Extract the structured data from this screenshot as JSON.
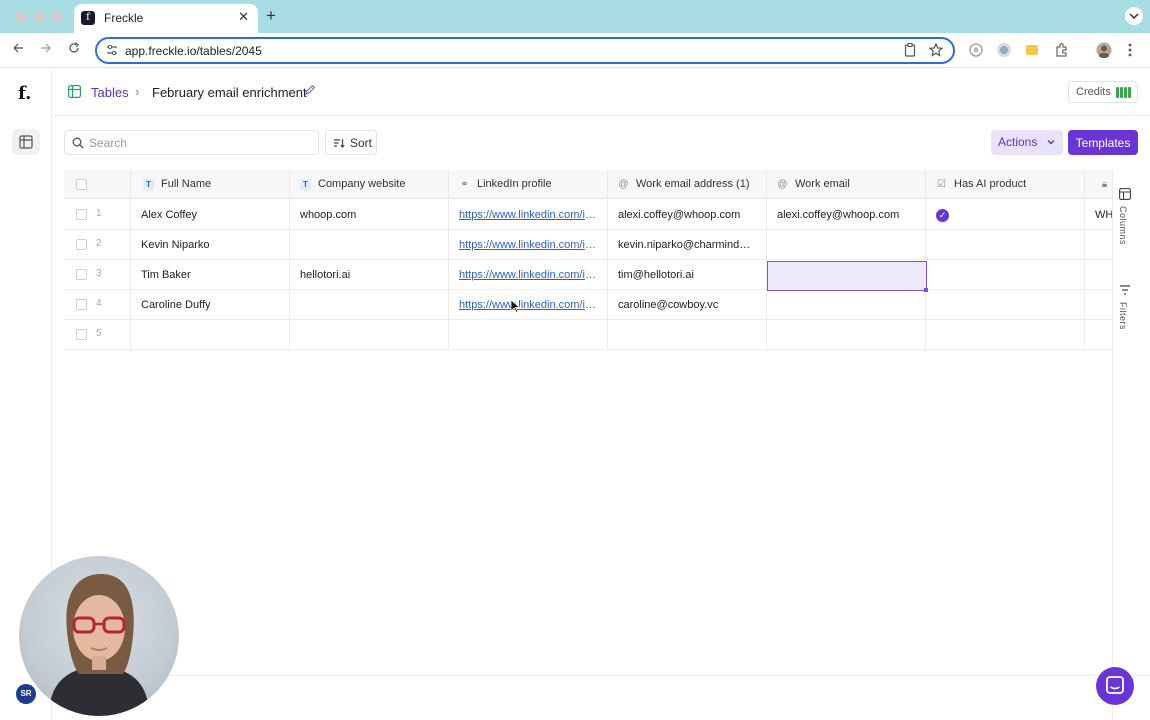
{
  "browser": {
    "tab_title": "Freckle",
    "tab_favicon_letter": "f",
    "url": "app.freckle.io/tables/2045"
  },
  "app": {
    "logo": "f.",
    "avatar_initials": "SR"
  },
  "breadcrumb": {
    "tables_label": "Tables",
    "separator": "›",
    "table_title": "February email enrichment"
  },
  "credits": {
    "label": "Credits",
    "level": 1.0
  },
  "toolbar": {
    "search_placeholder": "Search",
    "sort_label": "Sort",
    "actions_label": "Actions",
    "templates_label": "Templates"
  },
  "grid": {
    "columns": [
      {
        "label": "Full Name",
        "icon": "T"
      },
      {
        "label": "Company website",
        "icon": "T"
      },
      {
        "label": "LinkedIn profile",
        "icon": "link"
      },
      {
        "label": "Work email address (1)",
        "icon": "at"
      },
      {
        "label": "Work email",
        "icon": "at"
      },
      {
        "label": "Has AI product",
        "icon": "checkbox"
      }
    ],
    "rows": [
      {
        "num": "1",
        "full_name": "Alex Coffey",
        "company": "whoop.com",
        "linkedin": "https://www.linkedin.com/in...",
        "email1": "alexi.coffey@whoop.com",
        "email": "alexi.coffey@whoop.com",
        "has_ai": true,
        "extra": "WH"
      },
      {
        "num": "2",
        "full_name": "Kevin Niparko",
        "company": "",
        "linkedin": "https://www.linkedin.com/in...",
        "email1": "kevin.niparko@charmindust...",
        "email": "",
        "has_ai": false,
        "extra": ""
      },
      {
        "num": "3",
        "full_name": "Tim Baker",
        "company": "hellotori.ai",
        "linkedin": "https://www.linkedin.com/in...",
        "email1": "tim@hellotori.ai",
        "email": "",
        "has_ai": false,
        "extra": ""
      },
      {
        "num": "4",
        "full_name": "Caroline Duffy",
        "company": "",
        "linkedin": "https://www.linkedin.com/in...",
        "email1": "caroline@cowboy.vc",
        "email": "",
        "has_ai": false,
        "extra": ""
      },
      {
        "num": "5",
        "full_name": "",
        "company": "",
        "linkedin": "",
        "email1": "",
        "email": "",
        "has_ai": false,
        "extra": ""
      }
    ]
  },
  "rail": {
    "columns_label": "Columns",
    "filters_label": "Filters"
  },
  "colors": {
    "accent": "#6a35d6",
    "link": "#2b5fd9",
    "tabbar": "#a9dde5"
  }
}
